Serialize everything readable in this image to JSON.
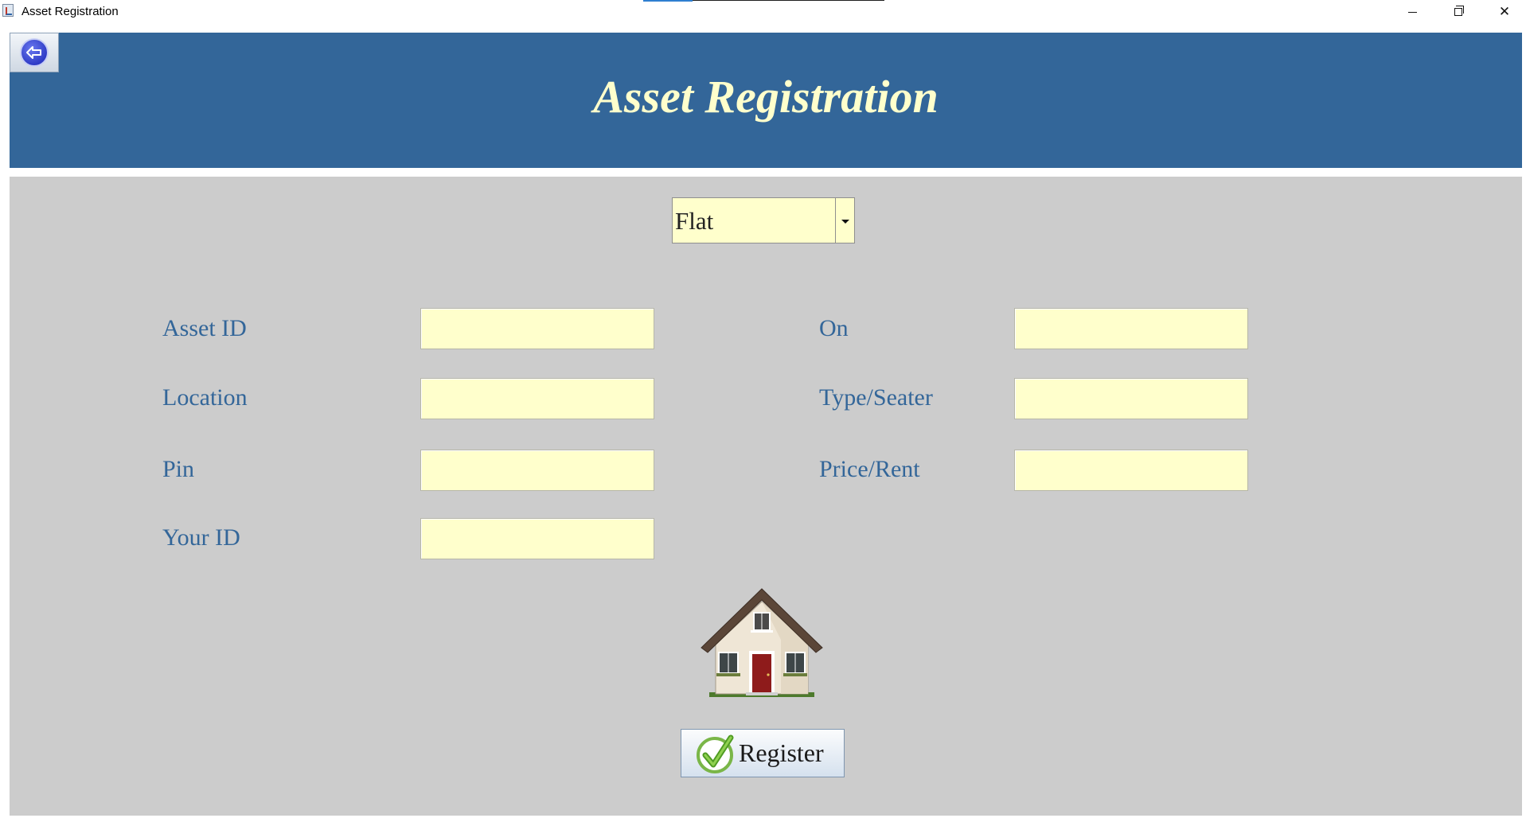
{
  "window": {
    "title": "Asset Registration"
  },
  "header": {
    "heading": "Asset Registration",
    "back_icon": "back-arrow-icon",
    "background_color": "#336699",
    "heading_color": "#ffffcc"
  },
  "form": {
    "asset_type": {
      "selected": "Flat"
    },
    "left_fields": [
      {
        "label": "Asset ID",
        "value": ""
      },
      {
        "label": "Location",
        "value": ""
      },
      {
        "label": "Pin",
        "value": ""
      },
      {
        "label": "Your ID",
        "value": ""
      }
    ],
    "right_fields": [
      {
        "label": "On",
        "value": ""
      },
      {
        "label": "Type/Seater",
        "value": ""
      },
      {
        "label": "Price/Rent",
        "value": ""
      }
    ],
    "image_icon": "house-icon",
    "register": {
      "label": "Register",
      "icon": "checkmark-icon"
    },
    "panel_color": "#cccccc",
    "field_color": "#ffffcc",
    "label_color": "#336699"
  }
}
